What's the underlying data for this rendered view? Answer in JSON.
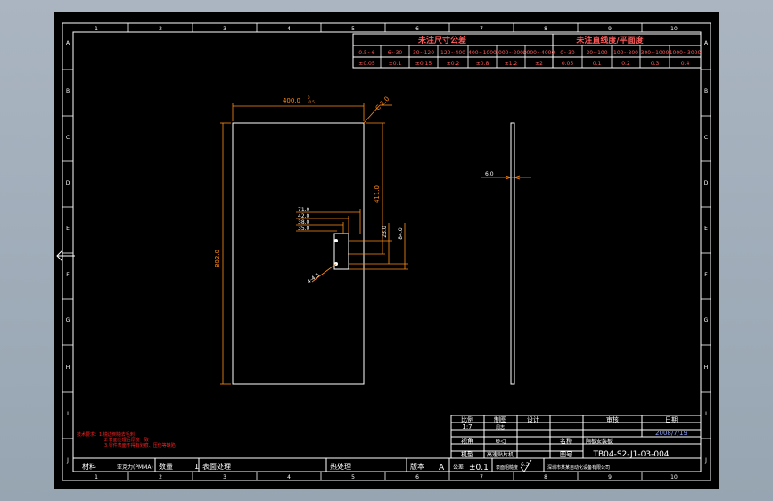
{
  "colors": {
    "background": "#000000",
    "frame": "#ffffff",
    "dimension": "#ff8c1a",
    "table_text": "#ff5a5a",
    "note": "#ff2020",
    "part_outline": "#ffffff",
    "title_text": "#ffffff",
    "title_value": "#8aa0ff"
  },
  "frame": {
    "top_numbers": [
      "1",
      "2",
      "3",
      "4",
      "5",
      "6",
      "7",
      "8",
      "9",
      "10"
    ],
    "bottom_numbers": [
      "1",
      "2",
      "3",
      "4",
      "5",
      "6",
      "7",
      "8",
      "9",
      "10"
    ],
    "side_letters": [
      "A",
      "B",
      "C",
      "D",
      "E",
      "F",
      "G",
      "H",
      "I",
      "J"
    ]
  },
  "tolerance_table": {
    "header_left": "未注尺寸公差",
    "header_right": "未注直线度/平面度",
    "left_ranges": [
      "0.5~6",
      "6~30",
      "30~120",
      "120~400",
      "400~1000",
      "1000~2000",
      "2000~4000"
    ],
    "left_values": [
      "±0.05",
      "±0.1",
      "±0.15",
      "±0.2",
      "±0.8",
      "±1.2",
      "±2"
    ],
    "right_ranges": [
      "0~30",
      "30~100",
      "100~300",
      "300~1000",
      "1000~3000"
    ],
    "right_values": [
      "0.05",
      "0.1",
      "0.2",
      "0.3",
      "0.4"
    ]
  },
  "dimensions": {
    "width": "400.0",
    "width_tol": "0\n-0.5",
    "chamfer": "C 2.0",
    "height": "802.0",
    "hole_from_top": "411.0",
    "hole_d1": "71.0",
    "hole_d2": "42.0",
    "hole_d3": "38.0",
    "hole_d4": "35.0",
    "hole_v1": "23.0",
    "hole_v2": "84.0",
    "hole_callout": "4-4.5",
    "thickness": "6.0"
  },
  "notes": {
    "line1": "技术要求：1.锐边倒钝去毛刺",
    "line2": "2.表面处理后厚度一致",
    "line3": "3.零件表面不得有划痕、压伤等缺陷"
  },
  "title_block": {
    "scale_label": "比例",
    "scale_value": "1:7",
    "drawn_label": "制图",
    "drawn_value": "周志",
    "design_label": "设计",
    "review_label": "审核",
    "date_label": "日期",
    "date_value": "2008/7/19",
    "view_label": "视角",
    "view_symbol": "⊕◁",
    "name_label": "名称",
    "name_value": "隔板安装板",
    "model_label": "机型",
    "model_value": "高速贴片机",
    "drawing_no_label": "图号",
    "drawing_no_value": "TB04-S2-J1-03-004",
    "material_label": "材料",
    "material_value": "亚克力(PMMA)",
    "qty_label": "数量",
    "qty_value": "1",
    "surface_label": "表面处理",
    "heat_label": "热处理",
    "version_label": "版本",
    "version_value": "A",
    "tolerance_label": "公差",
    "tolerance_value": "±0.1",
    "roughness_label": "表面粗糙度",
    "roughness_value": "6.3",
    "company": "深圳市某某自动化设备有限公司"
  }
}
